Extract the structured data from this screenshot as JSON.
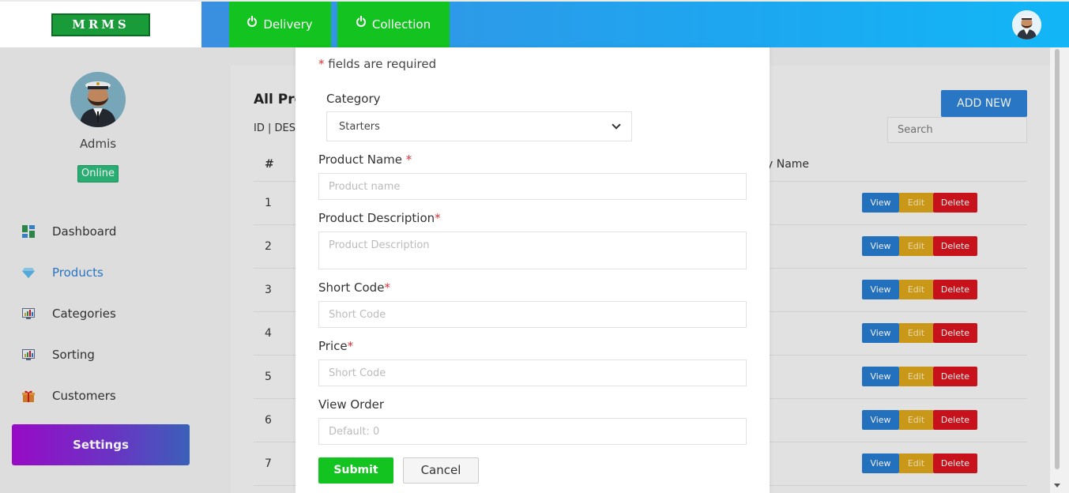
{
  "header": {
    "logo_text": "MRMS",
    "mode_buttons": [
      {
        "label": "Delivery",
        "icon": "power-icon"
      },
      {
        "label": "Collection",
        "icon": "power-icon"
      }
    ],
    "colors": {
      "mode_active": "#13c420",
      "bar_start": "#3a8fe0",
      "bar_end": "#12b6f6"
    }
  },
  "sidebar": {
    "user_name": "Admis",
    "status": "Online",
    "items": [
      {
        "label": "Dashboard",
        "icon": "dashboard-icon",
        "active": false
      },
      {
        "label": "Products",
        "icon": "diamond-icon",
        "active": true
      },
      {
        "label": "Categories",
        "icon": "chart-icon",
        "active": false
      },
      {
        "label": "Sorting",
        "icon": "chart-icon",
        "active": false
      },
      {
        "label": "Customers",
        "icon": "gift-icon",
        "active": false
      }
    ],
    "settings_label": "Settings"
  },
  "products_page": {
    "title": "All Pro",
    "sort_line": "ID | DESC",
    "add_new_label": "ADD NEW",
    "search_placeholder": "Search",
    "columns": {
      "number": "#",
      "category_name": "y Name"
    },
    "row_numbers": [
      "1",
      "2",
      "3",
      "4",
      "5",
      "6",
      "7"
    ],
    "actions": {
      "view": "View",
      "edit": "Edit",
      "delete": "Delete"
    }
  },
  "modal": {
    "required_note": "fields are required",
    "required_mark": "*",
    "category": {
      "label": "Category",
      "selected": "Starters"
    },
    "product_name": {
      "label": "Product Name",
      "placeholder": "Product name"
    },
    "product_description": {
      "label": "Product Description",
      "placeholder": "Product Description"
    },
    "short_code": {
      "label": "Short Code",
      "placeholder": "Short Code"
    },
    "price": {
      "label": "Price",
      "placeholder": "Short Code"
    },
    "view_order": {
      "label": "View Order",
      "placeholder": "Default: 0"
    },
    "submit_label": "Submit",
    "cancel_label": "Cancel"
  }
}
